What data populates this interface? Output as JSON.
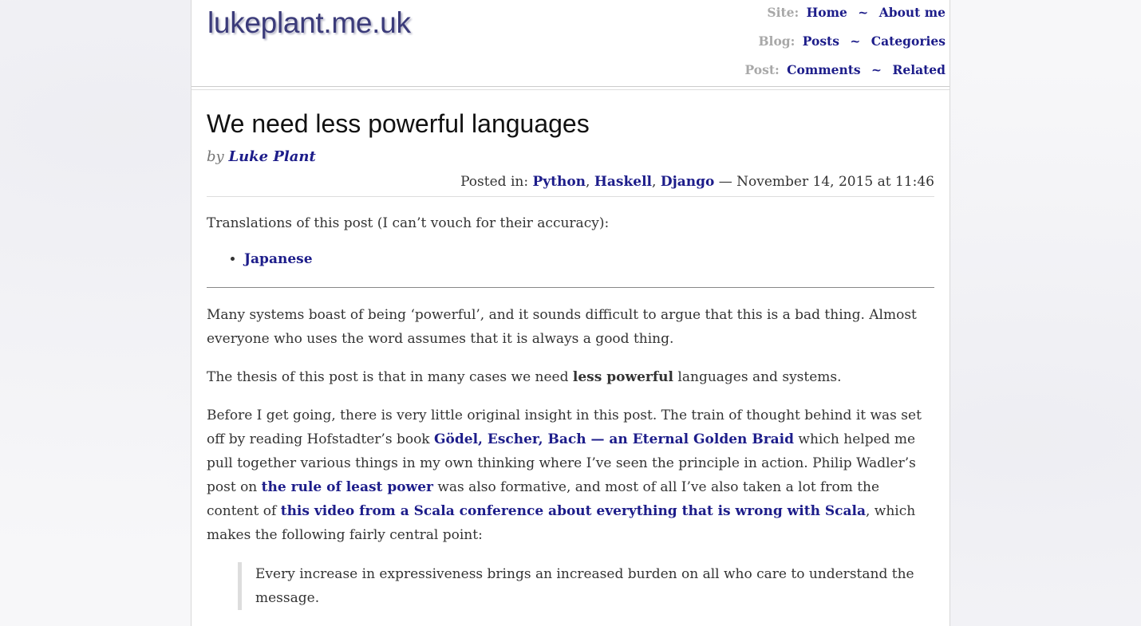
{
  "site": {
    "title": "lukeplant.me.uk"
  },
  "nav": {
    "site_label": "Site:",
    "home": "Home",
    "about": "About me",
    "blog_label": "Blog:",
    "posts": "Posts",
    "categories": "Categories",
    "post_label": "Post:",
    "comments": "Comments",
    "related": "Related",
    "separator": "~"
  },
  "post": {
    "title": "We need less powerful languages",
    "by": "by",
    "author": "Luke Plant",
    "posted_in": "Posted in:",
    "categories": [
      "Python",
      "Haskell",
      "Django"
    ],
    "comma": ",",
    "date": "— November 14, 2015 at 11:46",
    "translations_intro": "Translations of this post (I can’t vouch for their accuracy):",
    "translations": [
      "Japanese"
    ],
    "p1": "Many systems boast of being ‘powerful’, and it sounds difficult to argue that this is a bad thing. Almost everyone who uses the word assumes that it is always a good thing.",
    "p2_before": "The thesis of this post is that in many cases we need ",
    "p2_strong": "less powerful",
    "p2_after": " languages and systems.",
    "p3_a": "Before I get going, there is very little original insight in this post. The train of thought behind it was set off by reading Hofstadter’s book ",
    "p3_link1": "Gödel, Escher, Bach — an Eternal Golden Braid",
    "p3_b": " which helped me pull together various things in my own thinking where I’ve seen the principle in action. Philip Wadler’s post on ",
    "p3_link2": "the rule of least power",
    "p3_c": " was also formative, and most of all I’ve also taken a lot from the content of ",
    "p3_link3": "this video from a Scala conference about everything that is wrong with Scala",
    "p3_d": ", which makes the following fairly central point:",
    "quote": "Every increase in expressiveness brings an increased burden on all who care to understand the message."
  }
}
